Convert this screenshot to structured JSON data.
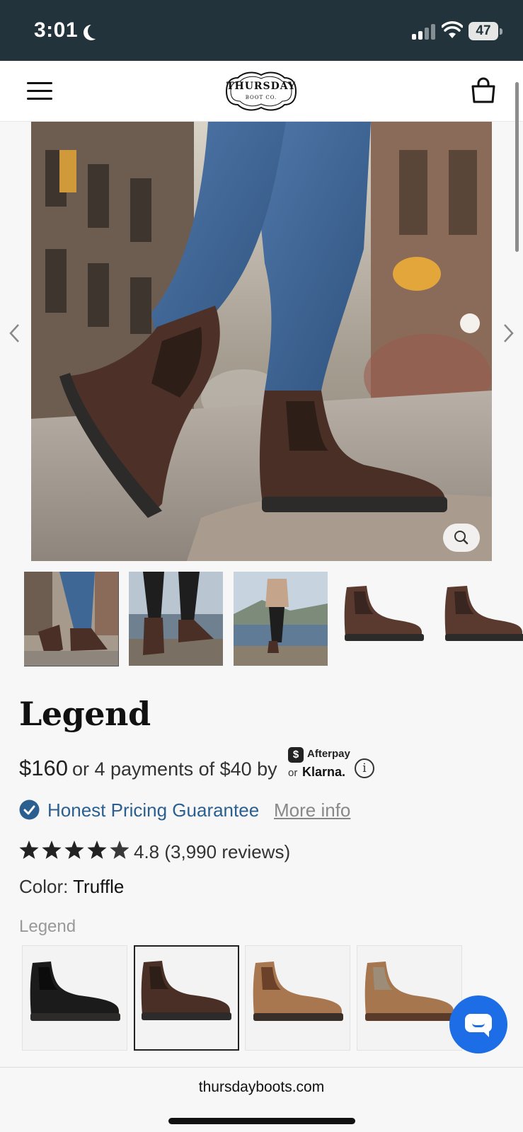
{
  "status_bar": {
    "time": "3:01",
    "battery": "47",
    "icons": [
      "moon-icon",
      "signal-icon",
      "wifi-icon",
      "battery-icon"
    ]
  },
  "header": {
    "brand_name": "THURSDAY",
    "brand_sub": "BOOT CO.",
    "icons": [
      "menu-icon",
      "cart-icon"
    ]
  },
  "gallery": {
    "icons": [
      "chevron-left-icon",
      "chevron-right-icon",
      "zoom-icon"
    ]
  },
  "product": {
    "title": "Legend",
    "price": "$160",
    "installments": "or 4 payments of $40 by",
    "afterpay_label": "Afterpay",
    "afterpay_symbol": "$",
    "klarna_or": "or",
    "klarna_label": "Klarna.",
    "guarantee_text": "Honest Pricing Guarantee",
    "more_info": "More info",
    "rating_text": "4.8 (3,990 reviews)",
    "rating_value": 4.8,
    "rating_max": 5,
    "color_label": "Color:",
    "color_value": "Truffle",
    "variant_label": "Legend",
    "swatches": [
      {
        "name": "black",
        "color": "#1b1b1b",
        "selected": false
      },
      {
        "name": "truffle",
        "color": "#4a2f26",
        "selected": true
      },
      {
        "name": "tan",
        "color": "#a9774f",
        "selected": false
      },
      {
        "name": "tan-taupe",
        "color": "#a6764f",
        "selected": false
      }
    ]
  },
  "browser": {
    "url": "thursdayboots.com"
  },
  "colors": {
    "status_bar_bg": "#22333b",
    "accent_blue": "#2a5f8f",
    "chat_blue": "#1d6ee6"
  }
}
